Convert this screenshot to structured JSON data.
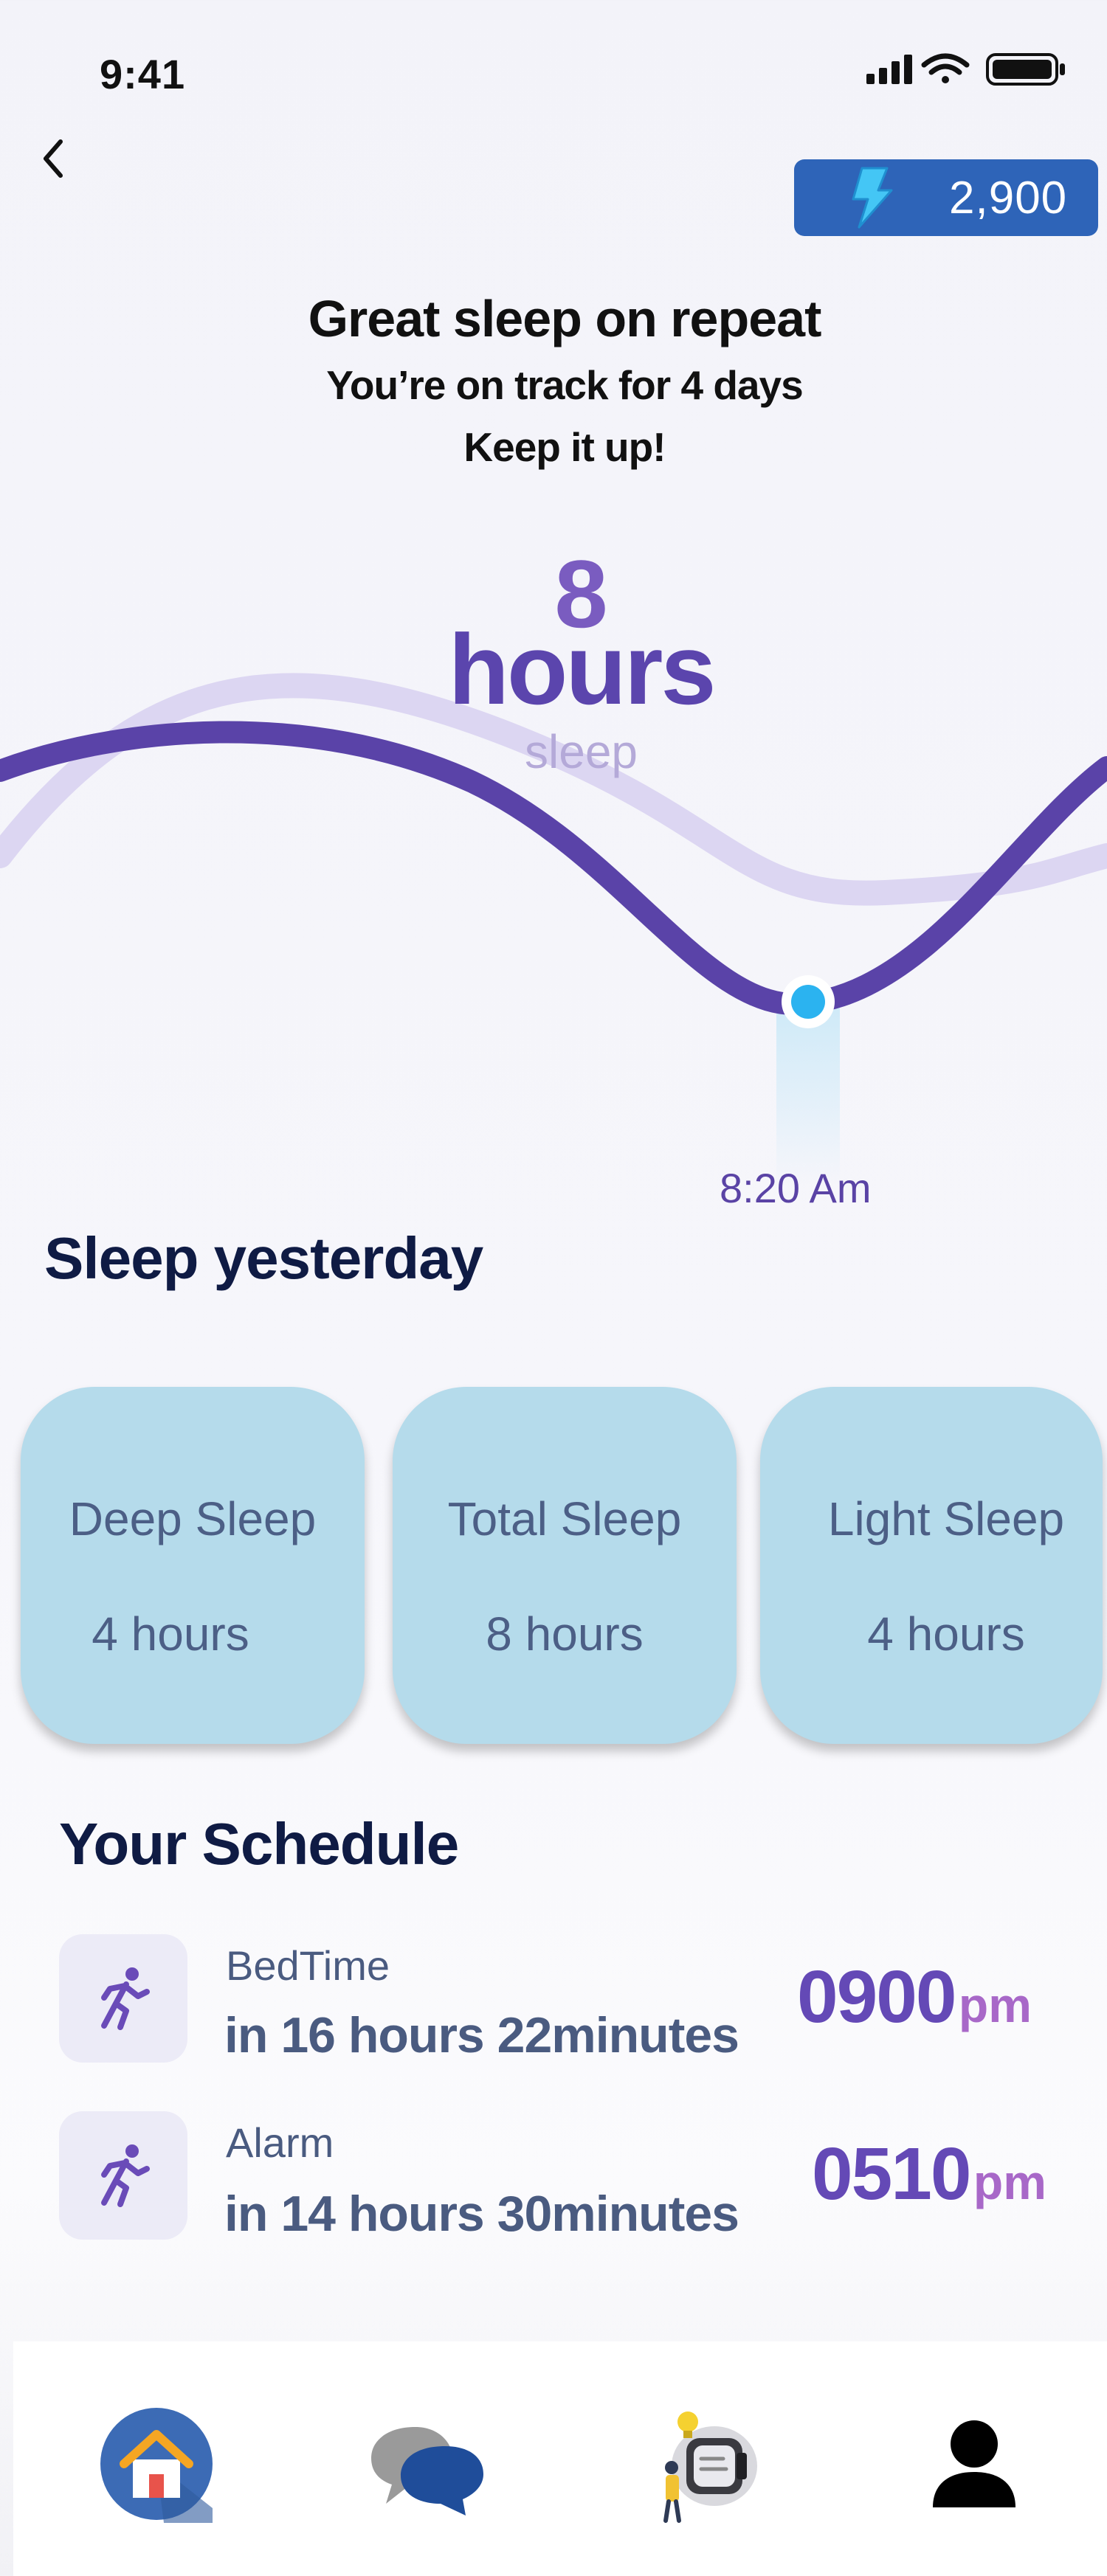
{
  "status_bar": {
    "time": "9:41"
  },
  "header": {
    "points": "2,900"
  },
  "hero": {
    "title": "Great sleep on repeat",
    "subtitle_line1": "You’re on track for 4 days",
    "subtitle_line2": "Keep it up!",
    "hours_value": "8",
    "hours_unit": "hours",
    "hours_sub": "sleep",
    "marker_time": "8:20 Am"
  },
  "sleep_yesterday": {
    "heading": "Sleep yesterday",
    "cards": [
      {
        "label": "Deep Sleep",
        "value": "4 hours"
      },
      {
        "label": "Total Sleep",
        "value": "8 hours"
      },
      {
        "label": "Light Sleep",
        "value": "4 hours"
      }
    ]
  },
  "schedule": {
    "heading": "Your Schedule",
    "items": [
      {
        "name": "BedTime",
        "eta": "in 16 hours 22minutes",
        "time": "0900",
        "ampm": "pm"
      },
      {
        "name": "Alarm",
        "eta": "in 14 hours 30minutes",
        "time": "0510",
        "ampm": "pm"
      }
    ]
  },
  "nav": {
    "items": [
      "home-icon",
      "chat-icon",
      "smartwatch-icon",
      "profile-icon"
    ]
  },
  "colors": {
    "accent": "#5b45ad",
    "badge": "#2e64b8",
    "card": "#b5dbeb",
    "marker": "#2bb3f0"
  }
}
